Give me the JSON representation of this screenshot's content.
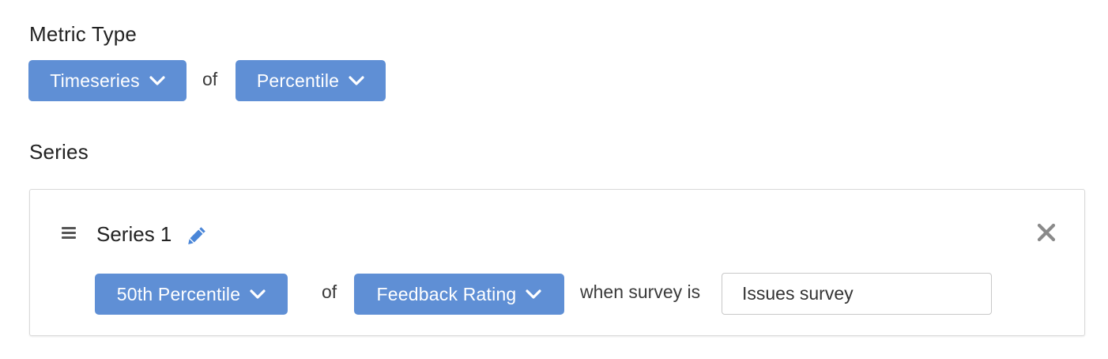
{
  "metric_type": {
    "title": "Metric Type",
    "type_dropdown": {
      "selected": "Timeseries"
    },
    "connector": "of",
    "aggregation_dropdown": {
      "selected": "Percentile"
    }
  },
  "series_section": {
    "title": "Series",
    "series": [
      {
        "name": "Series 1",
        "stat_dropdown": {
          "selected": "50th Percentile"
        },
        "connector": "of",
        "field_dropdown": {
          "selected": "Feedback Rating"
        },
        "condition_label": "when survey is",
        "condition_input": {
          "value": "Issues survey"
        }
      }
    ]
  },
  "icons": {
    "dropdown_chevron": "chevron-down-icon",
    "drag_handle": "drag-handle-icon",
    "edit": "pencil-icon",
    "remove": "close-icon"
  },
  "colors": {
    "accent": "#5f8fd5",
    "edit_icon": "#4a86d8",
    "close_icon": "#8a8a8a"
  }
}
